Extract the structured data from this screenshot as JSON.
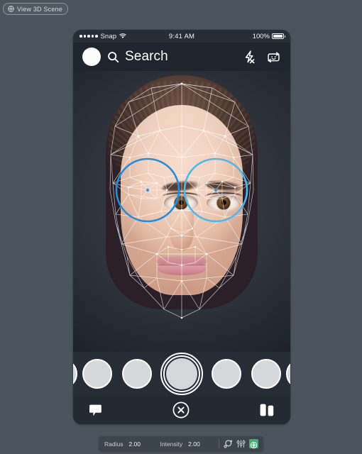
{
  "viewport_badge": {
    "label": "View 3D Scene",
    "icon": "3d-scene-icon"
  },
  "phone": {
    "status_bar": {
      "signal_dots": 5,
      "carrier": "Snap",
      "wifi_icon": "wifi-icon",
      "time": "9:41 AM",
      "battery_percent": "100%",
      "battery_icon": "battery-full-icon"
    },
    "header": {
      "avatar": "profile-avatar",
      "search_icon": "search-icon",
      "search_placeholder": "Search",
      "search_label": "Search",
      "flash_icon": "flash-off-icon",
      "camera_flip_icon": "camera-flip-icon"
    },
    "camera": {
      "subject": "face-preview",
      "mesh_overlay": "face-mesh-wireframe",
      "eye_marker_left_color": "#1f8fe0",
      "eye_marker_right_color": "#4db8ea",
      "eye_marker_dot_color": "#2a9bdf"
    },
    "carousel": {
      "lens_count": 7,
      "shutter_label": "capture-button"
    },
    "bottom_nav": {
      "chat_icon": "chat-bubble-icon",
      "close_icon": "close-circle-icon",
      "stories_icon": "stories-icon"
    }
  },
  "property_bar": {
    "fields": [
      {
        "label": "Radius",
        "value": "2.00"
      },
      {
        "label": "Intensity",
        "value": "2.00"
      }
    ],
    "tools": [
      {
        "icon": "snap-rotate-icon",
        "active": false
      },
      {
        "icon": "align-grid-icon",
        "active": false
      },
      {
        "icon": "symmetry-icon",
        "active": true
      }
    ],
    "accent_color": "#3fae72"
  }
}
